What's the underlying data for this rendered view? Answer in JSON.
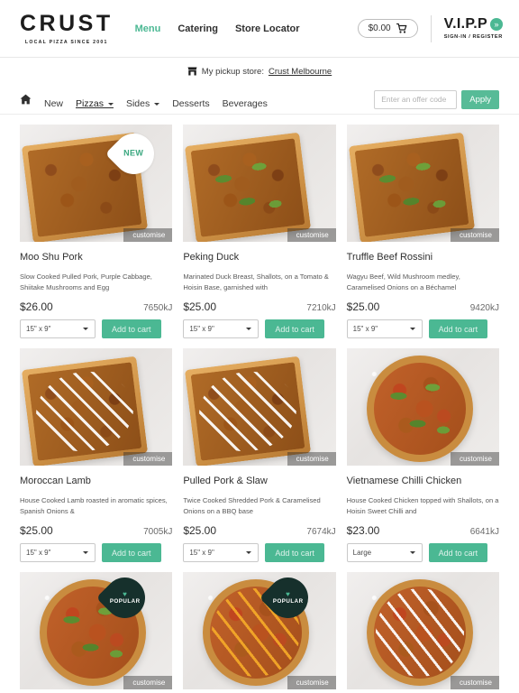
{
  "header": {
    "brand_name": "CRUST",
    "brand_tagline": "LOCAL PIZZA SINCE 2001",
    "nav": [
      {
        "label": "Menu",
        "active": true
      },
      {
        "label": "Catering",
        "active": false
      },
      {
        "label": "Store Locator",
        "active": false
      }
    ],
    "cart_total": "$0.00",
    "cart_icon": "shopping-cart-icon",
    "vipp_label": "V.I.P.P",
    "vipp_chevron": "»",
    "vipp_sub": "SIGN-IN / REGISTER"
  },
  "pickup": {
    "icon": "store-icon",
    "label": "My pickup store:",
    "store_name": "Crust Melbourne"
  },
  "subnav": {
    "home_icon": "home-icon",
    "items": [
      {
        "label": "New",
        "caret": false,
        "active": false
      },
      {
        "label": "Pizzas",
        "caret": true,
        "active": true
      },
      {
        "label": "Sides",
        "caret": true,
        "active": false
      },
      {
        "label": "Desserts",
        "caret": false,
        "active": false
      },
      {
        "label": "Beverages",
        "caret": false,
        "active": false
      }
    ],
    "offer_placeholder": "Enter an offer code",
    "offer_value": "",
    "apply_label": "Apply"
  },
  "labels": {
    "customise": "customise",
    "badge_new": "NEW",
    "badge_popular": "POPULAR",
    "heart_icon": "heart-icon",
    "add_to_cart": "Add to cart"
  },
  "colors": {
    "accent_green": "#4bb893",
    "apply_green": "#57bb97",
    "badge_dark": "#16302c",
    "text_dark": "#2f2f2f"
  },
  "products": [
    {
      "name": "Moo Shu Pork",
      "description": "Slow Cooked Pulled Pork, Purple Cabbage, Shiitake Mushrooms and Egg",
      "price": "$26.00",
      "energy": "7650kJ",
      "size": "15\" x 9\"",
      "badge": "NEW",
      "shape": "slab",
      "style": "purple"
    },
    {
      "name": "Peking Duck",
      "description": "Marinated Duck Breast, Shallots, on a Tomato & Hoisin Base, garnished with",
      "price": "$25.00",
      "energy": "7210kJ",
      "size": "15\" x 9\"",
      "badge": null,
      "shape": "slab",
      "style": "greens"
    },
    {
      "name": "Truffle Beef Rossini",
      "description": "Wagyu Beef, Wild Mushroom medley, Caramelised Onions on a Béchamel",
      "price": "$25.00",
      "energy": "9420kJ",
      "size": "15\" x 9\"",
      "badge": null,
      "shape": "slab",
      "style": "greens"
    },
    {
      "name": "Moroccan Lamb",
      "description": "House Cooked Lamb roasted in aromatic spices, Spanish Onions &",
      "price": "$25.00",
      "energy": "7005kJ",
      "size": "15\" x 9\"",
      "badge": null,
      "shape": "slab",
      "style": "white-drizzle"
    },
    {
      "name": "Pulled Pork & Slaw",
      "description": "Twice Cooked Shredded Pork & Caramelised Onions on a BBQ base",
      "price": "$25.00",
      "energy": "7674kJ",
      "size": "15\" x 9\"",
      "badge": null,
      "shape": "slab",
      "style": "white-drizzle"
    },
    {
      "name": "Vietnamese Chilli Chicken",
      "description": "House Cooked Chicken topped with Shallots, on a Hoisin Sweet Chilli and",
      "price": "$23.00",
      "energy": "6641kJ",
      "size": "Large",
      "badge": null,
      "shape": "round",
      "style": "greens"
    },
    {
      "name": "",
      "description": "",
      "price": "",
      "energy": "",
      "size": "",
      "badge": "POPULAR",
      "shape": "round",
      "style": "greens"
    },
    {
      "name": "",
      "description": "",
      "price": "",
      "energy": "",
      "size": "",
      "badge": "POPULAR",
      "shape": "round",
      "style": "yellow-drizzle"
    },
    {
      "name": "",
      "description": "",
      "price": "",
      "energy": "",
      "size": "",
      "badge": null,
      "shape": "round",
      "style": "white-drizzle"
    }
  ]
}
